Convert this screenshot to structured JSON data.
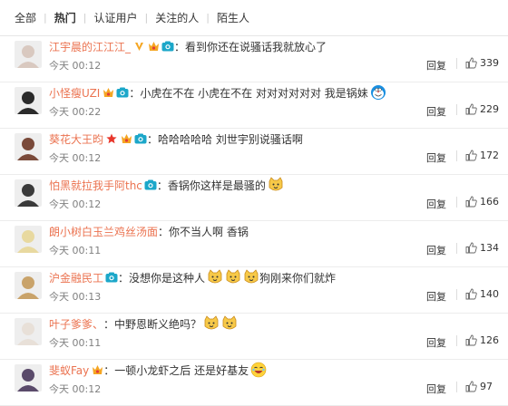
{
  "tabs": [
    {
      "label": "全部",
      "active": false
    },
    {
      "label": "热门",
      "active": true
    },
    {
      "label": "认证用户",
      "active": false
    },
    {
      "label": "关注的人",
      "active": false
    },
    {
      "label": "陌生人",
      "active": false
    }
  ],
  "reply_label": "回复",
  "comments": [
    {
      "user": "江宇晨的江江江_",
      "badges": [
        "v-badge",
        "vip-badge",
        "camera-badge"
      ],
      "text": "：看到你还在说骚话我就放心了",
      "emojis": [],
      "time": "今天 00:12",
      "likes": "339"
    },
    {
      "user": "小怪瘦UZI",
      "badges": [
        "vip-badge",
        "camera-badge"
      ],
      "text": "：小虎在不在 小虎在不在 对对对对对对 我是锅妹",
      "emojis": [
        "doraemon-emoji"
      ],
      "time": "今天 00:22",
      "likes": "229"
    },
    {
      "user": "葵花大王昀",
      "badges": [
        "star-badge",
        "vip-badge",
        "camera-badge"
      ],
      "text": "：哈哈哈哈哈 刘世宇别说骚话啊",
      "emojis": [],
      "time": "今天 00:12",
      "likes": "172"
    },
    {
      "user": "怕黑就拉我手阿thc",
      "badges": [
        "camera-badge"
      ],
      "text": "：香锅你这样是最骚的",
      "emojis": [
        "cat-emoji"
      ],
      "time": "今天 00:12",
      "likes": "166"
    },
    {
      "user": "朗小树白玉兰鸡丝汤面",
      "badges": [],
      "text": "：你不当人啊  香锅",
      "emojis": [],
      "time": "今天 00:11",
      "likes": "134"
    },
    {
      "user": "沪金融民工",
      "badges": [
        "camera-badge"
      ],
      "text": "：没想你是这种人",
      "emojis": [
        "cat-emoji",
        "cat-emoji",
        "cat-emoji"
      ],
      "text_after": "狗刚来你们就炸",
      "time": "今天 00:13",
      "likes": "140"
    },
    {
      "user": "叶子爹爹、",
      "badges": [],
      "text": "：中野恩断义绝吗？",
      "emojis": [
        "cat-emoji",
        "cat-emoji"
      ],
      "time": "今天 00:11",
      "likes": "126"
    },
    {
      "user": "斐蚁Fay",
      "badges": [
        "vip-badge"
      ],
      "text": "：一顿小龙虾之后 还是好基友",
      "emojis": [
        "laugh-emoji"
      ],
      "time": "今天 00:12",
      "likes": "97"
    }
  ],
  "colors": {
    "username": "#eb7350",
    "accent_orange": "#f5a623",
    "camera_teal": "#1ca7c9"
  }
}
